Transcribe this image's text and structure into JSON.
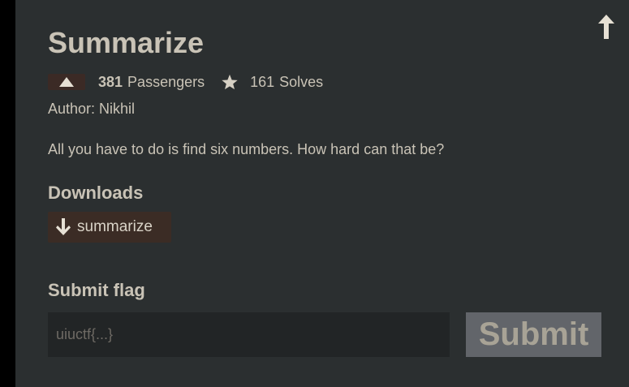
{
  "challenge": {
    "title": "Summarize",
    "passengers_count": "381",
    "passengers_label": "Passengers",
    "solves_count": "161",
    "solves_label": "Solves",
    "author": "Author: Nikhil",
    "description": "All you have to do is find six numbers. How hard can that be?"
  },
  "downloads": {
    "heading": "Downloads",
    "items": [
      {
        "label": "summarize",
        "icon": "arrow-down-icon"
      }
    ]
  },
  "submit": {
    "heading": "Submit flag",
    "placeholder": "uiuctf{...}",
    "value": "",
    "button_label": "Submit"
  },
  "icons": {
    "scroll_top": "arrow-up-icon",
    "upvote": "triangle-up-icon",
    "solves": "star-icon"
  },
  "colors": {
    "background": "#2b2f30",
    "text": "#c9c3b6",
    "download_bg": "#3b2c25",
    "input_bg": "#222526",
    "submit_bg": "#62656a"
  }
}
